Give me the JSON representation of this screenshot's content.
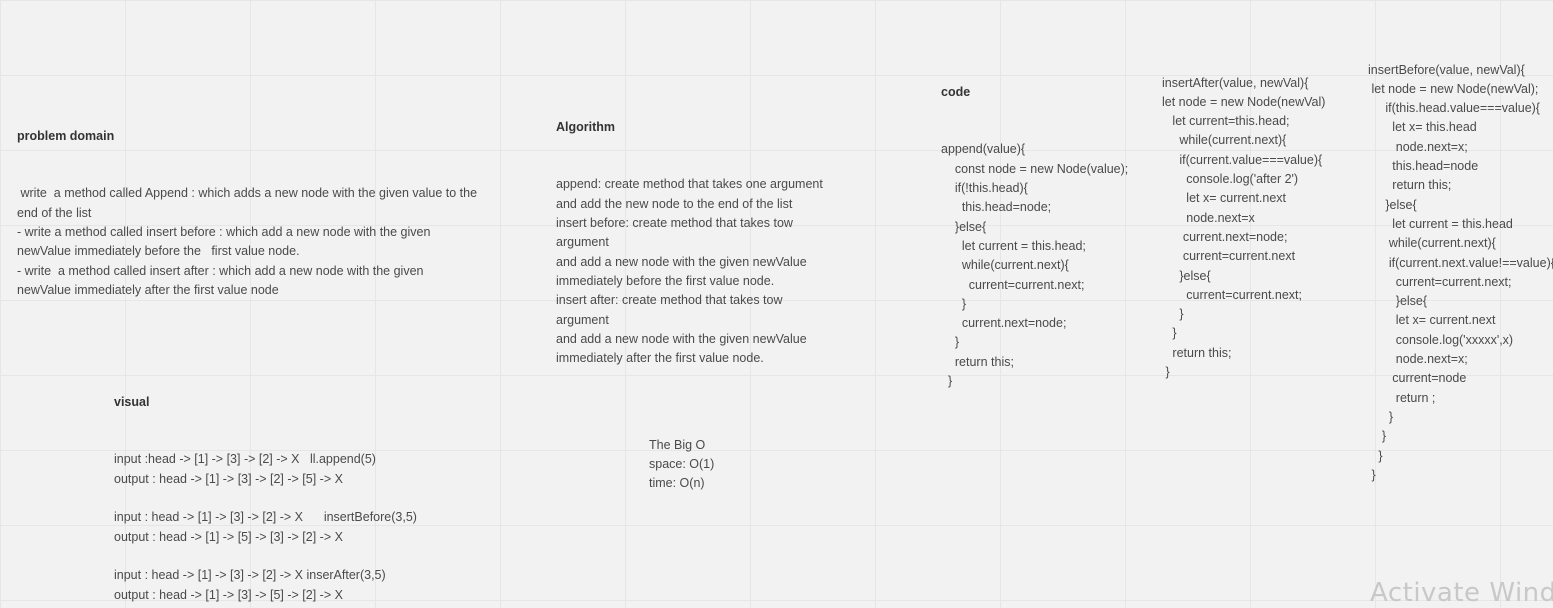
{
  "problem_domain": {
    "heading": "problem domain",
    "lines": [
      " write  a method called Append : which adds a new node with the given value to the",
      "end of the list",
      "- write a method called insert before : which add a new node with the given",
      "newValue immediately before the   first value node.",
      "- write  a method called insert after : which add a new node with the given",
      "newValue immediately after the first value node"
    ]
  },
  "algorithm": {
    "heading": "Algorithm",
    "lines": [
      "append: create method that takes one argument",
      "and add the new node to the end of the list",
      "insert before: create method that takes tow",
      "argument",
      "and add a new node with the given newValue",
      "immediately before the first value node.",
      "insert after: create method that takes tow",
      "argument",
      "and add a new node with the given newValue",
      "immediately after the first value node."
    ]
  },
  "code": {
    "heading": "code",
    "lines": [
      "append(value){",
      "    const node = new Node(value);",
      "    if(!this.head){",
      "      this.head=node;",
      "    }else{",
      "      let current = this.head;",
      "      while(current.next){",
      "        current=current.next;",
      "      }",
      "      current.next=node;",
      "    }",
      "    return this;",
      "  }"
    ]
  },
  "insert_after_code": {
    "lines": [
      "insertAfter(value, newVal){",
      "let node = new Node(newVal)",
      "   let current=this.head;",
      "     while(current.next){",
      "     if(current.value===value){",
      "       console.log('after 2')",
      "       let x= current.next",
      "       node.next=x",
      "      current.next=node;",
      "      current=current.next",
      "     }else{",
      "       current=current.next;",
      "     }",
      "   }",
      "   return this;",
      " }"
    ]
  },
  "insert_before_code": {
    "lines": [
      "insertBefore(value, newVal){",
      " let node = new Node(newVal);",
      "     if(this.head.value===value){",
      "       let x= this.head",
      "        node.next=x;",
      "       this.head=node",
      "       return this;",
      "     }else{",
      "       let current = this.head",
      "      while(current.next){",
      "      if(current.next.value!==value){",
      "        current=current.next;",
      "        }else{",
      "        let x= current.next",
      "        console.log('xxxxx',x)",
      "        node.next=x;",
      "       current=node",
      "        return ;",
      "      }",
      "    }",
      "   }",
      " }"
    ]
  },
  "visual": {
    "heading": "visual",
    "lines": [
      "input :head -> [1] -> [3] -> [2] -> X   ll.append(5)",
      "output : head -> [1] -> [3] -> [2] -> [5] -> X",
      "",
      "input : head -> [1] -> [3] -> [2] -> X      insertBefore(3,5)",
      "output : head -> [1] -> [5] -> [3] -> [2] -> X",
      "",
      "input : head -> [1] -> [3] -> [2] -> X inserAfter(3,5)",
      "output : head -> [1] -> [3] -> [5] -> [2] -> X"
    ]
  },
  "big_o": {
    "lines": [
      "The Big O",
      "space: O(1)",
      "time: O(n)"
    ]
  },
  "watermark": "Activate Windows",
  "colors": {
    "background": "#f2f2f2",
    "grid": "#e6e6e6",
    "text": "#4a4a4a",
    "heading": "#333333",
    "watermark": "#c8c8c8"
  }
}
